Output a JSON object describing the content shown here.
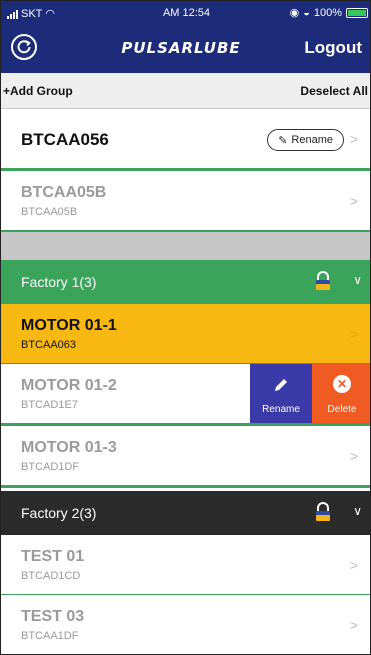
{
  "status_bar": {
    "carrier": "SKT",
    "time": "AM 12:54",
    "battery": "100%"
  },
  "app_bar": {
    "logo": "PULSARLUBE",
    "logout_label": "Logout"
  },
  "toolbar": {
    "add_group_label": "+Add Group",
    "deselect_all_label": "Deselect All"
  },
  "ungrouped": [
    {
      "name": "BTCAA056",
      "selected": true,
      "rename_label": "Rename"
    },
    {
      "name": "BTCAA05B",
      "id": "BTCAA05B"
    }
  ],
  "groups": [
    {
      "title": "Factory 1(3)",
      "items": [
        {
          "name": "MOTOR 01-1",
          "id": "BTCAA063",
          "active": true
        },
        {
          "name": "MOTOR 01-2",
          "id": "BTCAD1E7"
        },
        {
          "name": "MOTOR 01-3",
          "id": "BTCAD1DF"
        }
      ]
    },
    {
      "title": "Factory 2(3)",
      "items": [
        {
          "name": "TEST 01",
          "id": "BTCAD1CD"
        },
        {
          "name": "TEST 03",
          "id": "BTCAA1DF"
        }
      ]
    }
  ],
  "swipe_actions": {
    "rename_label": "Rename",
    "delete_label": "Delete"
  },
  "icons": {
    "refresh": "refresh-icon",
    "lock": "lock-icon",
    "caret": "chevron-down-icon",
    "chevron": "chevron-right-icon",
    "pencil": "pencil-icon",
    "delete": "close-circle-icon"
  },
  "colors": {
    "header": "#1d2c7a",
    "group_green": "#3aa55a",
    "group_dark": "#2b2b2b",
    "active_row": "#f8b812",
    "rename_action": "#3a3aa8",
    "delete_action": "#f05a23"
  }
}
